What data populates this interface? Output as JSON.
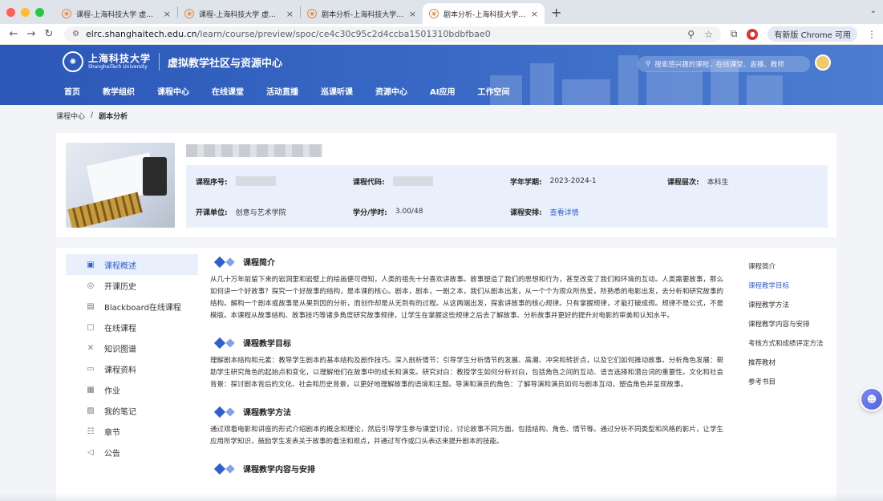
{
  "browser": {
    "tabs": [
      {
        "title": "课程-上海科技大学 虚拟教学社",
        "active": false
      },
      {
        "title": "课程-上海科技大学 虚拟教学社",
        "active": false
      },
      {
        "title": "剧本分析-上海科技大学 虚拟教",
        "active": false
      },
      {
        "title": "剧本分析-上海科技大学 虚拟教",
        "active": true
      }
    ],
    "url_host": "elrc.shanghaitech.edu.cn",
    "url_path": "/learn/course/preview/spoc/ce4c30c95c2d4ccba1501310bdbfbae0",
    "update_label": "有新版 Chrome 可用",
    "colors": {
      "red": "#ff5f57",
      "yellow": "#febc2e",
      "green": "#28c840"
    }
  },
  "site": {
    "univ_cn": "上海科技大学",
    "univ_en": "ShanghaiTech University",
    "title": "虚拟教学社区与资源中心",
    "search_placeholder": "搜索感兴趣的课程、在线课堂、直播、教师",
    "nav": [
      "首页",
      "教学组织",
      "课程中心",
      "在线课堂",
      "活动直播",
      "巡课听课",
      "资源中心",
      "AI应用",
      "工作空间"
    ],
    "accent": "#2f5fd1"
  },
  "breadcrumb": {
    "root": "课程中心",
    "sep": "/",
    "current": "剧本分析"
  },
  "course": {
    "fields": {
      "seq_label": "课程序号:",
      "code_label": "课程代码:",
      "term_label": "学年学期:",
      "term_value": "2023-2024-1",
      "level_label": "课程层次:",
      "level_value": "本科生",
      "unit_label": "开课单位:",
      "unit_value": "创意与艺术学院",
      "credit_label": "学分/学时:",
      "credit_value": "3.00/48",
      "schedule_label": "课程安排:",
      "schedule_link": "查看详情"
    }
  },
  "sidebar": {
    "items": [
      {
        "label": "课程概述",
        "icon": "overview-icon",
        "glyph": "▣",
        "active": true
      },
      {
        "label": "开课历史",
        "icon": "history-icon",
        "glyph": "◎",
        "active": false
      },
      {
        "label": "Blackboard在线课程",
        "icon": "blackboard-icon",
        "glyph": "▤",
        "active": false
      },
      {
        "label": "在线课程",
        "icon": "online-course-icon",
        "glyph": "▢",
        "active": false
      },
      {
        "label": "知识图谱",
        "icon": "knowledge-graph-icon",
        "glyph": "✕",
        "active": false
      },
      {
        "label": "课程资料",
        "icon": "folder-icon",
        "glyph": "▭",
        "active": false
      },
      {
        "label": "作业",
        "icon": "homework-icon",
        "glyph": "▦",
        "active": false
      },
      {
        "label": "我的笔记",
        "icon": "notes-icon",
        "glyph": "▨",
        "active": false
      },
      {
        "label": "章节",
        "icon": "chapter-icon",
        "glyph": "☷",
        "active": false
      },
      {
        "label": "公告",
        "icon": "announcement-icon",
        "glyph": "◁",
        "active": false
      }
    ]
  },
  "sections": [
    {
      "title": "课程简介",
      "body": "从几十万年前留下来的岩洞里和岩壁上的绘画便可得知，人类的祖先十分喜欢讲故事。故事塑造了我们的思想和行为，甚至改变了我们和环境的互动。人类需要故事，那么如何讲一个好故事？探究一个好故事的结构，是本课的核心。剧本，剧本，一剧之本，我们从剧本出发，从一个个为观众所热爱，所熟悉的电影出发，去分析和研究故事的结构。解构一个剧本或故事是从果到因的分析，而创作却是从无到有的过程。从这两端出发，探索讲故事的核心规律。只有掌握规律，才能打破成规。规律不是公式，不是模版。本课程从故事结构、故事技巧等诸多角度研究故事规律，让学生在掌握这些规律之后去了解故事、分析故事并更好的提升对电影的审美和认知水平。"
    },
    {
      "title": "课程教学目标",
      "body": "理解剧本结构和元素：教导学生剧本的基本结构及剧作技巧。深入剖析情节：引导学生分析情节的发展、高潮、冲突和转折点，以及它们如何推动故事。分析角色发展：帮助学生研究角色的起始点和变化，以理解他们在故事中的成长和演变。研究对白：教授学生如何分析对白，包括角色之间的互动、语言选择和潜台词的重要性。文化和社会背景：探讨剧本背后的文化、社会和历史背景，以更好地理解故事的语境和主题。导演和演员的角色：了解导演和演员如何与剧本互动，塑造角色并呈现故事。"
    },
    {
      "title": "课程教学方法",
      "body": "通过观看电影和讲座的形式介绍剧本的概念和理论，然后引导学生参与课堂讨论，讨论故事不同方面，包括结构、角色、情节等。通过分析不同类型和风格的影片，让学生应用所学知识，鼓励学生发表关于故事的看法和观点，并通过写作或口头表达来提升剧本的技能。"
    },
    {
      "title": "课程教学内容与安排",
      "body": ""
    }
  ],
  "toc": {
    "items": [
      {
        "label": "课程简介",
        "active": false
      },
      {
        "label": "课程教学目标",
        "active": true
      },
      {
        "label": "课程教学方法",
        "active": false
      },
      {
        "label": "课程教学内容与安排",
        "active": false
      },
      {
        "label": "考核方式和成绩评定方法",
        "active": false
      },
      {
        "label": "推荐教材",
        "active": false
      },
      {
        "label": "参考书目",
        "active": false
      }
    ]
  }
}
